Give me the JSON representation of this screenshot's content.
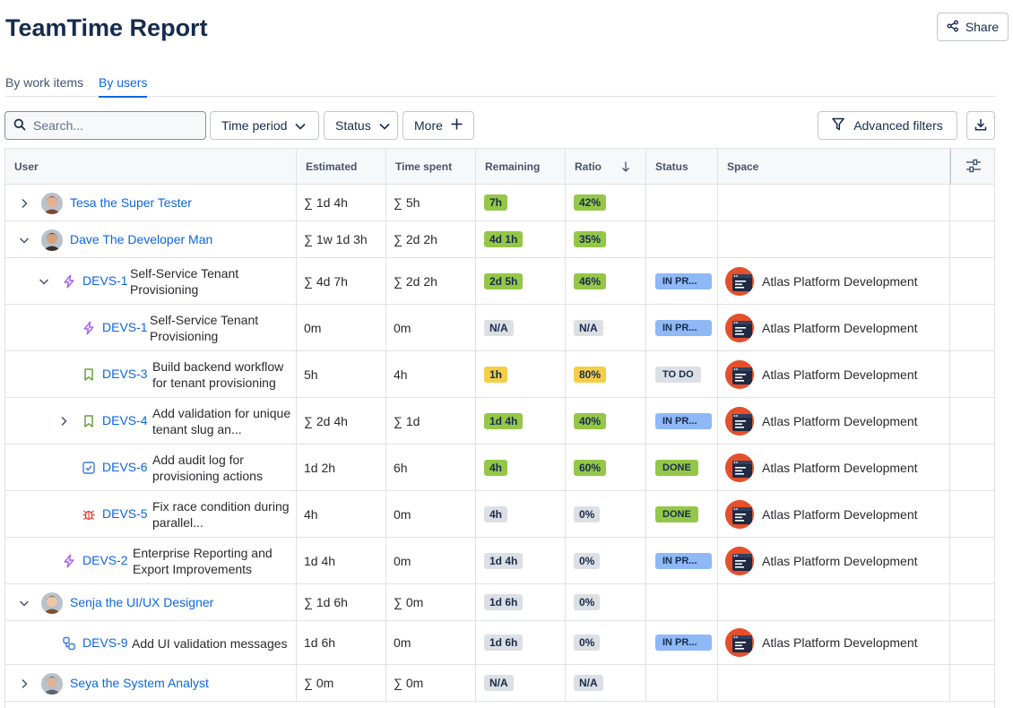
{
  "page": {
    "title": "TeamTime Report",
    "share_label": "Share"
  },
  "tabs": [
    {
      "label": "By work items"
    },
    {
      "label": "By users"
    }
  ],
  "toolbar": {
    "search_placeholder": "Search...",
    "time_period_label": "Time period",
    "status_label": "Status",
    "more_label": "More",
    "advanced_filters_label": "Advanced filters"
  },
  "columns": {
    "user": "User",
    "estimated": "Estimated",
    "time_spent": "Time spent",
    "remaining": "Remaining",
    "ratio": "Ratio",
    "status": "Status",
    "space": "Space"
  },
  "space_name": "Atlas Platform Development",
  "colors": {
    "accent": "#0c66e4",
    "green": "#94c748",
    "yellow": "#f5cd47",
    "gray": "#dcdfe4",
    "blue": "#8fb8f6"
  },
  "rows": [
    {
      "type": "user",
      "name": "Tesa the Super Tester",
      "expanded": false,
      "estimated": "∑ 1d 4h",
      "spent": "∑ 5h",
      "remaining": "7h",
      "ratio": "42%",
      "remaining_color": "green",
      "ratio_color": "green"
    },
    {
      "type": "user",
      "name": "Dave The Developer Man",
      "expanded": true,
      "estimated": "∑ 1w 1d 3h",
      "spent": "∑ 2d 2h",
      "remaining": "4d 1h",
      "ratio": "35%",
      "remaining_color": "green",
      "ratio_color": "green"
    },
    {
      "type": "item",
      "icon": "epic-icon",
      "key": "DEVS-1",
      "summary": "Self-Service Tenant Provisioning",
      "expanded": true,
      "estimated": "∑ 4d 7h",
      "spent": "∑ 2d 2h",
      "remaining": "2d 5h",
      "ratio": "46%",
      "remaining_color": "green",
      "ratio_color": "green",
      "status": "IN PR...",
      "status_color": "blue"
    },
    {
      "type": "item",
      "icon": "epic-icon",
      "key": "DEVS-1",
      "summary": "Self-Service Tenant Provisioning",
      "estimated": "0m",
      "spent": "0m",
      "remaining": "N/A",
      "ratio": "N/A",
      "remaining_color": "gray",
      "ratio_color": "gray",
      "status": "IN PR...",
      "status_color": "blue"
    },
    {
      "type": "item",
      "icon": "story-icon",
      "key": "DEVS-3",
      "summary": "Build backend workflow for tenant provisioning",
      "estimated": "5h",
      "spent": "4h",
      "remaining": "1h",
      "ratio": "80%",
      "remaining_color": "yellow",
      "ratio_color": "yellow",
      "status": "TO DO",
      "status_color": "gray"
    },
    {
      "type": "item",
      "icon": "story-icon",
      "key": "DEVS-4",
      "summary": "Add validation for unique tenant slug an...",
      "expanded": false,
      "estimated": "∑ 2d 4h",
      "spent": "∑ 1d",
      "remaining": "1d 4h",
      "ratio": "40%",
      "remaining_color": "green",
      "ratio_color": "green",
      "status": "IN PR...",
      "status_color": "blue"
    },
    {
      "type": "item",
      "icon": "task-icon",
      "key": "DEVS-6",
      "summary": "Add audit log for provisioning actions",
      "estimated": "1d 2h",
      "spent": "6h",
      "remaining": "4h",
      "ratio": "60%",
      "remaining_color": "green",
      "ratio_color": "green",
      "status": "DONE",
      "status_color": "green"
    },
    {
      "type": "item",
      "icon": "bug-icon",
      "key": "DEVS-5",
      "summary": "Fix race condition during parallel...",
      "estimated": "4h",
      "spent": "0m",
      "remaining": "4h",
      "ratio": "0%",
      "remaining_color": "gray",
      "ratio_color": "gray",
      "status": "DONE",
      "status_color": "green"
    },
    {
      "type": "item",
      "icon": "epic-icon",
      "key": "DEVS-2",
      "summary": "Enterprise Reporting and Export Improvements",
      "estimated": "1d 4h",
      "spent": "0m",
      "remaining": "1d 4h",
      "ratio": "0%",
      "remaining_color": "gray",
      "ratio_color": "gray",
      "status": "IN PR...",
      "status_color": "blue"
    },
    {
      "type": "user",
      "name": "Senja the UI/UX Designer",
      "expanded": true,
      "estimated": "∑ 1d 6h",
      "spent": "∑ 0m",
      "remaining": "1d 6h",
      "ratio": "0%",
      "remaining_color": "gray",
      "ratio_color": "gray"
    },
    {
      "type": "item",
      "icon": "subtask-icon",
      "key": "DEVS-9",
      "summary": "Add UI validation messages",
      "estimated": "1d 6h",
      "spent": "0m",
      "remaining": "1d 6h",
      "ratio": "0%",
      "remaining_color": "gray",
      "ratio_color": "gray",
      "status": "IN PR...",
      "status_color": "blue"
    },
    {
      "type": "user",
      "name": "Seya the System Analyst",
      "expanded": false,
      "estimated": "∑ 0m",
      "spent": "∑ 0m",
      "remaining": "N/A",
      "ratio": "N/A",
      "remaining_color": "gray",
      "ratio_color": "gray"
    }
  ]
}
